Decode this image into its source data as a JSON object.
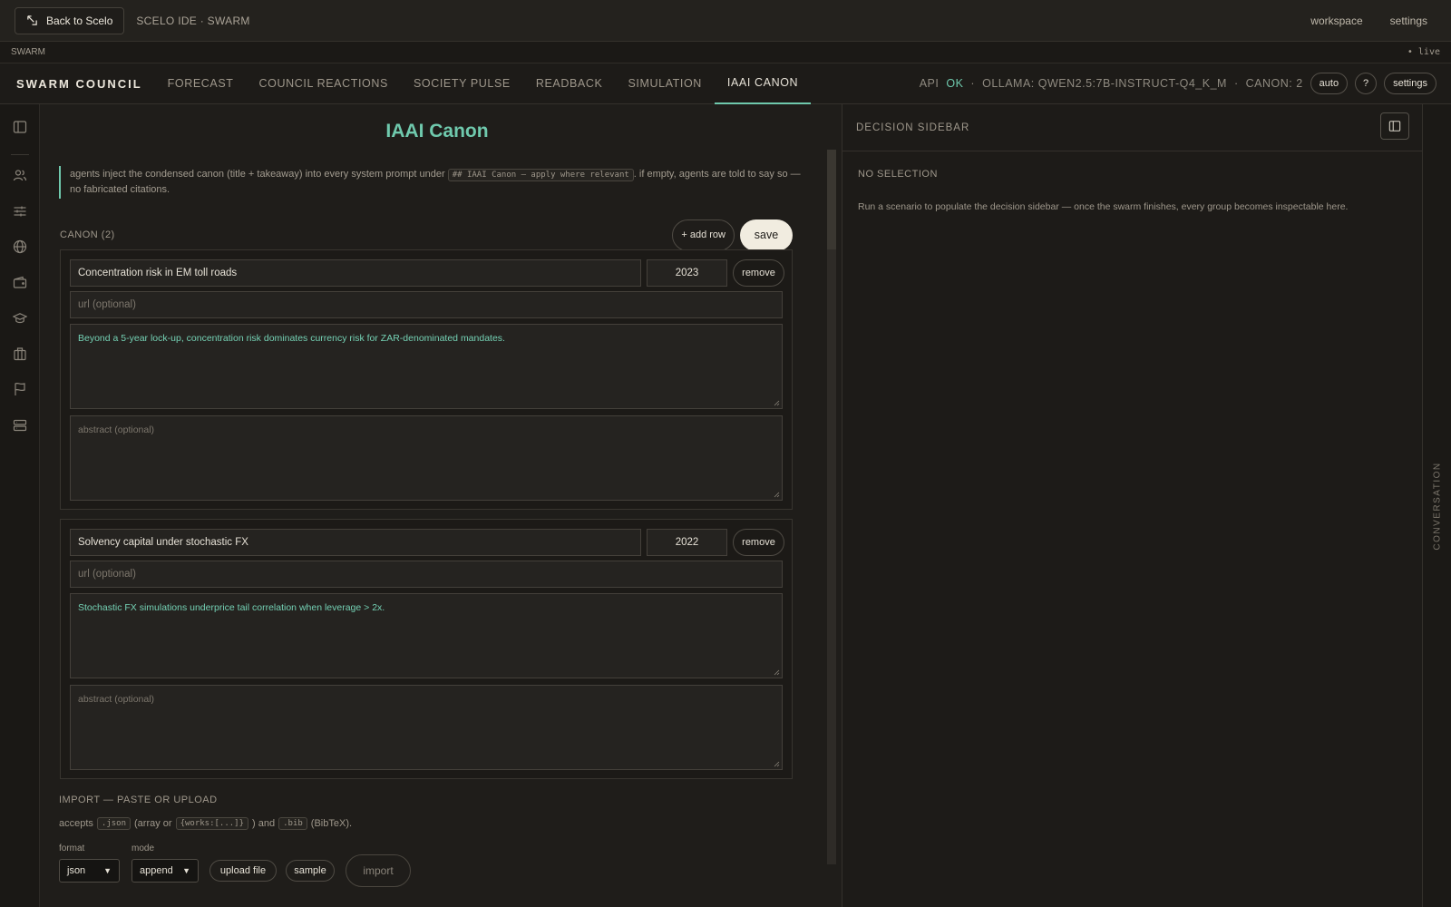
{
  "topbar": {
    "back_label": "Back to Scelo",
    "app_title": "SCELO IDE · SWARM",
    "links": [
      "workspace",
      "settings"
    ]
  },
  "strip": {
    "label": "SWARM",
    "live": "• live"
  },
  "nav": {
    "brand": "SWARM COUNCIL",
    "tabs": [
      {
        "label": "FORECAST",
        "active": false
      },
      {
        "label": "COUNCIL REACTIONS",
        "active": false
      },
      {
        "label": "SOCIETY PULSE",
        "active": false
      },
      {
        "label": "READBACK",
        "active": false
      },
      {
        "label": "SIMULATION",
        "active": false
      },
      {
        "label": "IAAI CANON",
        "active": true
      }
    ],
    "status": {
      "api_label": "API",
      "api_value": "OK",
      "sep": "·",
      "ollama": "OLLAMA: QWEN2.5:7B-INSTRUCT-Q4_K_M",
      "canon": "CANON: 2"
    },
    "buttons": {
      "auto": "auto",
      "help": "?",
      "settings": "settings"
    },
    "accent": "#6fc9ad"
  },
  "rail": {
    "icons": [
      "sidebar-toggle-icon",
      "users-icon",
      "sliders-icon",
      "globe-icon",
      "wallet-icon",
      "graduation-cap-icon",
      "briefcase-icon",
      "flag-icon",
      "database-icon"
    ]
  },
  "main": {
    "title": "IAAI Canon",
    "note": {
      "pre": "agents inject the condensed canon (title + takeaway) into every system prompt under",
      "code": "## IAAI Canon — apply where relevant",
      "post": ". if empty, agents are told to say so —",
      "line2": "no fabricated citations."
    },
    "canon_label": "CANON (2)",
    "add_row": "+ add row",
    "save": "save",
    "rows": [
      {
        "title": "Concentration risk in EM toll roads",
        "year": "2023",
        "remove": "remove",
        "url_placeholder": "url (optional)",
        "takeaway": "Beyond a 5-year lock-up, concentration risk dominates currency risk for ZAR-denominated mandates.",
        "abstract_placeholder": "abstract (optional)"
      },
      {
        "title": "Solvency capital under stochastic FX",
        "year": "2022",
        "remove": "remove",
        "url_placeholder": "url (optional)",
        "takeaway": "Stochastic FX simulations underprice tail correlation when leverage > 2x.",
        "abstract_placeholder": "abstract (optional)"
      }
    ],
    "import": {
      "title": "IMPORT — PASTE OR UPLOAD",
      "accepts_pre": "accepts",
      "code1": ".json",
      "mid1": "(array or",
      "code2": "{works:[...]}",
      "mid2": ") and",
      "code3": ".bib",
      "post": "(BibTeX).",
      "format_label": "format",
      "format_value": "json",
      "mode_label": "mode",
      "mode_value": "append",
      "upload": "upload file",
      "sample": "sample",
      "import": "import"
    }
  },
  "sidebar": {
    "title": "DECISION SIDEBAR",
    "no_selection": "NO SELECTION",
    "message": "Run a scenario to populate the decision sidebar — once the swarm finishes, every group becomes inspectable here."
  },
  "conversation": {
    "label": "CONVERSATION"
  }
}
